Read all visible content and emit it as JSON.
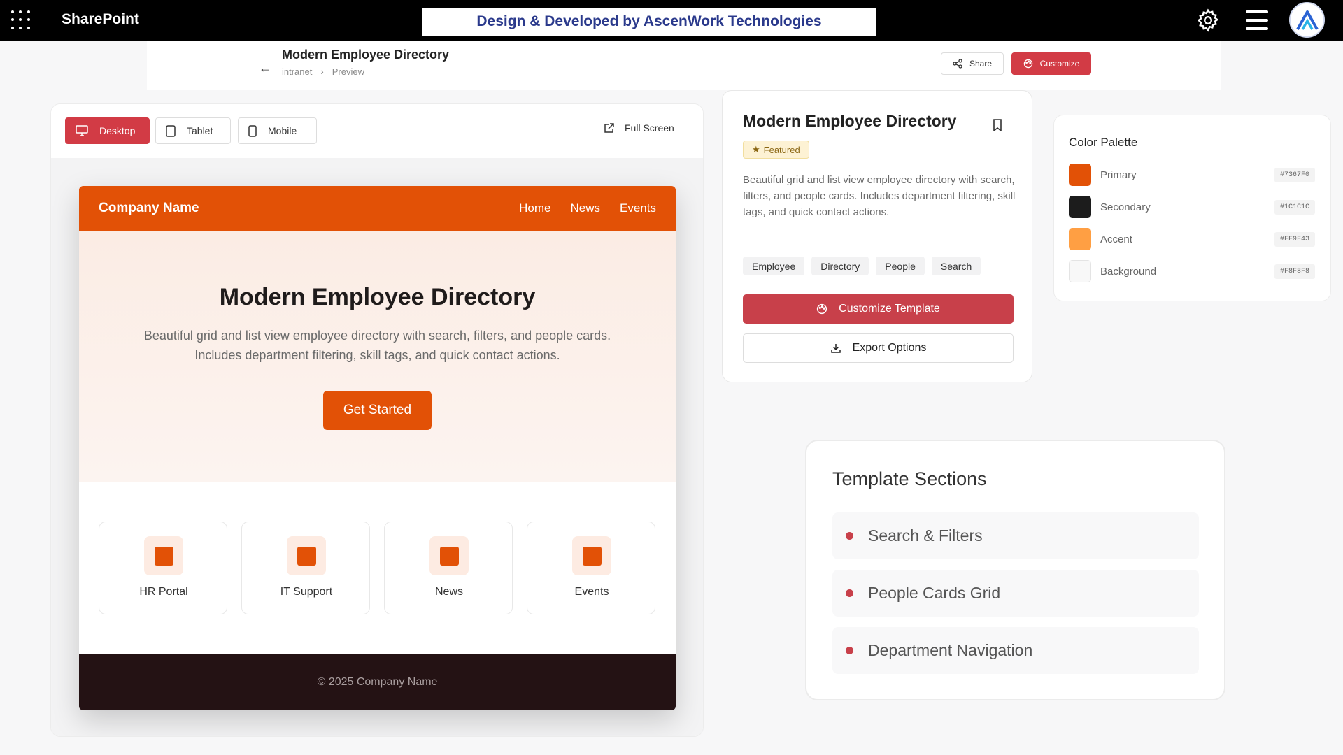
{
  "topbar": {
    "brand": "SharePoint",
    "banner": "Design & Developed by AscenWork Technologies"
  },
  "header": {
    "title": "Modern Employee Directory",
    "breadcrumb": [
      "intranet",
      "Preview"
    ],
    "share_label": "Share",
    "customize_label": "Customize"
  },
  "preview": {
    "devices": [
      {
        "label": "Desktop",
        "active": true
      },
      {
        "label": "Tablet",
        "active": false
      },
      {
        "label": "Mobile",
        "active": false
      }
    ],
    "fullscreen_label": "Full Screen",
    "site": {
      "logo": "Company Name",
      "nav": [
        "Home",
        "News",
        "Events"
      ],
      "hero_title": "Modern Employee Directory",
      "hero_subtitle_line1": "Beautiful grid and list view employee directory with search, filters, and people cards.",
      "hero_subtitle_line2": "Includes department filtering, skill tags, and quick contact actions.",
      "cta": "Get Started",
      "tiles": [
        "HR Portal",
        "IT Support",
        "News",
        "Events"
      ],
      "footer": "© 2025 Company Name"
    }
  },
  "details": {
    "title": "Modern Employee Directory",
    "badge": "Featured",
    "description": "Beautiful grid and list view employee directory with search, filters, and people cards. Includes department filtering, skill tags, and quick contact actions.",
    "tags": [
      "Employee",
      "Directory",
      "People",
      "Search"
    ],
    "customize_template_label": "Customize Template",
    "export_label": "Export Options"
  },
  "palette": {
    "title": "Color Palette",
    "colors": [
      {
        "name": "Primary",
        "hex": "#7367F0",
        "swatch": "#e25106"
      },
      {
        "name": "Secondary",
        "hex": "#1C1C1C",
        "swatch": "#1c1c1c"
      },
      {
        "name": "Accent",
        "hex": "#FF9F43",
        "swatch": "#ff9f43"
      },
      {
        "name": "Background",
        "hex": "#F8F8F8",
        "swatch": "#f8f8f8"
      }
    ]
  },
  "sections": {
    "title": "Template Sections",
    "items": [
      "Search & Filters",
      "People Cards Grid",
      "Department Navigation"
    ]
  },
  "colors": {
    "brand_orange": "#e25106",
    "accent_red": "#d23b45",
    "footer_dark": "#241214"
  }
}
